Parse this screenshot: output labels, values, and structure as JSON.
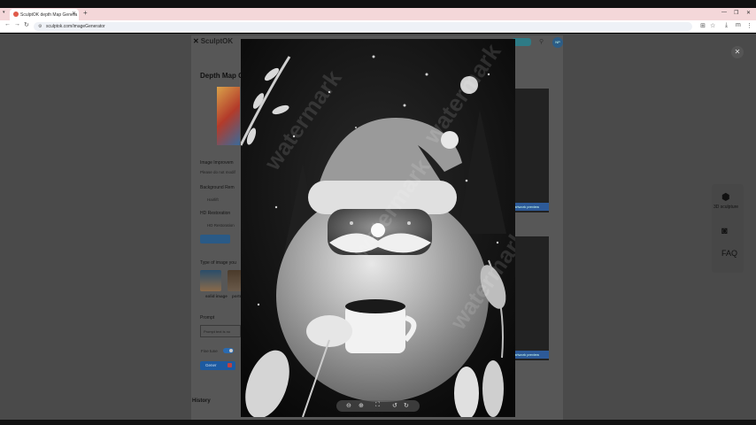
{
  "browser": {
    "tab_title": "SculptOK depth Map Genera",
    "tab_close": "✕",
    "new_tab": "+",
    "url": "sculptok.com/imageGenerator",
    "window_controls": [
      "—",
      "❐",
      "✕"
    ]
  },
  "header": {
    "logo_text": "SculptOK",
    "avatar_text": "NP"
  },
  "page": {
    "title": "Depth Map G",
    "image_improvement_label": "Image Improvem",
    "image_improvement_link": "Please do not modif",
    "background_removal_label": "Background Rem",
    "background_removal_option": "Hairlift",
    "hd_restoration_label": "HD Restoration",
    "hd_restoration_option": "HD Restoration",
    "type_of_image_label": "Type of image you",
    "type_options": [
      "solid image",
      "portr ima"
    ],
    "prompt_label": "Prompt",
    "prompt_placeholder": "Prompt text is no",
    "fine_tune_label": "Fine tune",
    "generate_button": "Gener",
    "history_label": "History",
    "result_preview_label": "artwork preview"
  },
  "sidebar": {
    "sculpture_label": "3D sculpture",
    "faq_label": "FAQ"
  },
  "modal": {
    "close": "✕",
    "toolbar_icons": [
      "zoom-out-icon",
      "zoom-in-icon",
      "fit-icon",
      "rotate-left-icon",
      "rotate-right-icon"
    ],
    "watermark_text": "watermark"
  },
  "colors": {
    "tabstrip": "#f4d7d9",
    "page_overlay": "#4a4a4a",
    "accent_blue": "#1d5aa0"
  }
}
